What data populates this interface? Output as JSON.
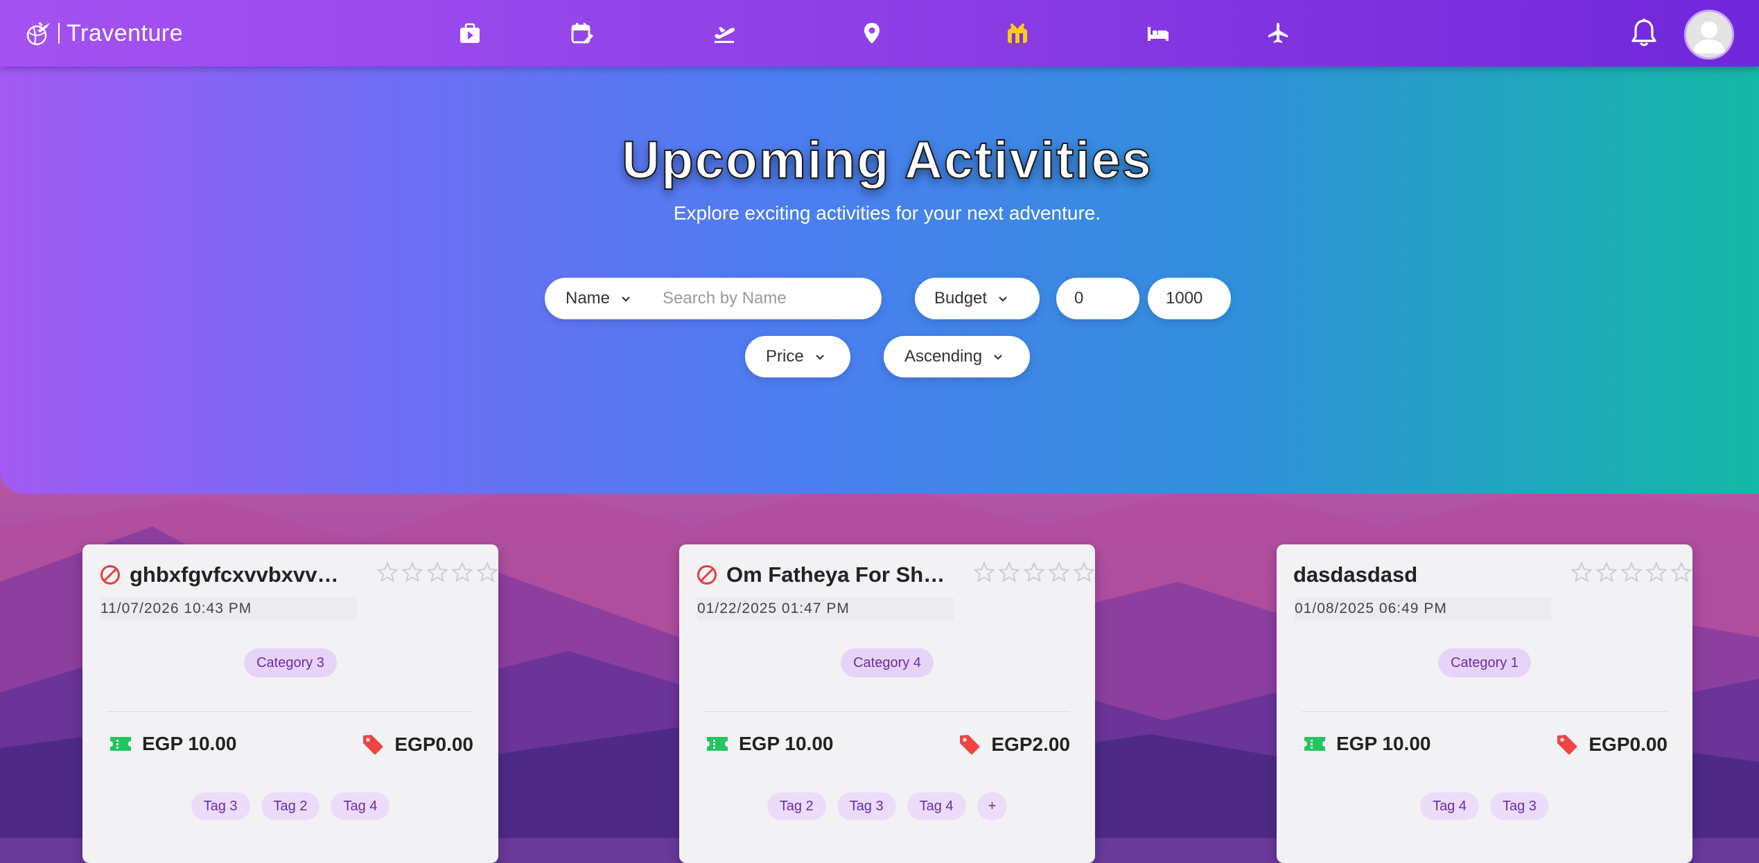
{
  "app": {
    "brand": "Traventure"
  },
  "nav": {
    "icons": [
      {
        "name": "video-icon",
        "active": false
      },
      {
        "name": "calendar-edit-icon",
        "active": false
      },
      {
        "name": "plane-departure-icon",
        "active": false
      },
      {
        "name": "map-pin-icon",
        "active": false
      },
      {
        "name": "activities-icon",
        "active": true
      },
      {
        "name": "bed-icon",
        "active": false
      },
      {
        "name": "plane-icon",
        "active": false
      }
    ],
    "active_color": "#facc15"
  },
  "hero": {
    "title": "Upcoming Activities",
    "subtitle": "Explore exciting activities for your next adventure."
  },
  "filters": {
    "search_by": "Name",
    "search_placeholder": "Search by Name",
    "search_value": "",
    "budget_label": "Budget",
    "min_value": "0",
    "max_value": "1000",
    "sort_by": "Price",
    "sort_order": "Ascending"
  },
  "cards": [
    {
      "title": "ghbxfgvfcxvvbxvvx…",
      "date": "11/07/2026  10:43  PM",
      "category": "Category 3",
      "price": "EGP 10.00",
      "discount": "EGP0.00",
      "tags": [
        "Tag 3",
        "Tag 2",
        "Tag 4"
      ],
      "rating": 0,
      "flagged": true
    },
    {
      "title": "Om Fatheya For Sh…",
      "date": "01/22/2025  01:47  PM",
      "category": "Category 4",
      "price": "EGP 10.00",
      "discount": "EGP2.00",
      "tags": [
        "Tag 2",
        "Tag 3",
        "Tag 4",
        "+"
      ],
      "rating": 0,
      "flagged": true
    },
    {
      "title": "dasdasdasd",
      "date": "01/08/2025  06:49  PM",
      "category": "Category 1",
      "price": "EGP 10.00",
      "discount": "EGP0.00",
      "tags": [
        "Tag 4",
        "Tag 3"
      ],
      "rating": 0,
      "flagged": false
    }
  ],
  "colors": {
    "ban": "#e53e3e",
    "ticket": "#22c55e",
    "price_tag": "#ef4444",
    "star_outline": "#c9c9cf"
  }
}
